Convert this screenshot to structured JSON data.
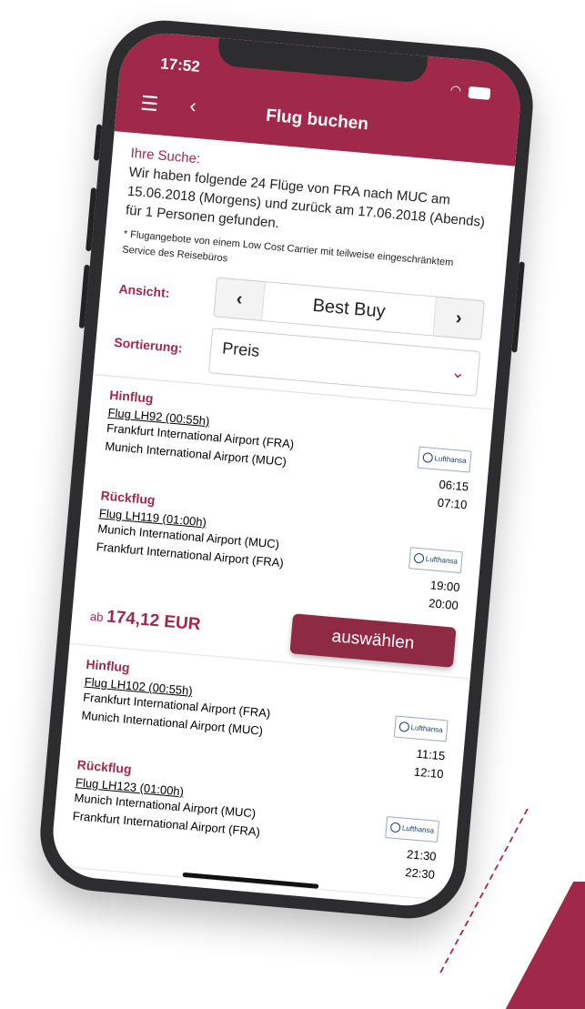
{
  "status_bar": {
    "time": "17:52"
  },
  "header": {
    "title": "Flug buchen"
  },
  "search": {
    "label": "Ihre Suche:",
    "text": "Wir haben folgende 24 Flüge von FRA nach MUC am 15.06.2018 (Morgens) und zurück am 17.06.2018 (Abends) für 1 Personen gefunden.",
    "note": "* Flugangebote von einem Low Cost Carrier mit teilweise eingeschränktem Service des Reisebüros"
  },
  "view": {
    "label": "Ansicht:",
    "value": "Best Buy"
  },
  "sort": {
    "label": "Sortierung:",
    "value": "Preis"
  },
  "airline_logo_text": "Lufthansa",
  "results": [
    {
      "outbound": {
        "title": "Hinflug",
        "flight": "Flug LH92 (00:55h)",
        "from": "Frankfurt International Airport (FRA)",
        "to": "Munich International Airport (MUC)",
        "dep": "06:15",
        "arr": "07:10"
      },
      "return": {
        "title": "Rückflug",
        "flight": "Flug LH119 (01:00h)",
        "from": "Munich International Airport (MUC)",
        "to": "Frankfurt International Airport (FRA)",
        "dep": "19:00",
        "arr": "20:00"
      },
      "price_prefix": "ab",
      "price": "174,12 EUR",
      "button": "auswählen"
    },
    {
      "outbound": {
        "title": "Hinflug",
        "flight": "Flug LH102 (00:55h)",
        "from": "Frankfurt International Airport (FRA)",
        "to": "Munich International Airport (MUC)",
        "dep": "11:15",
        "arr": "12:10"
      },
      "return": {
        "title": "Rückflug",
        "flight": "Flug LH123 (01:00h)",
        "from": "Munich International Airport (MUC)",
        "to": "Frankfurt International Airport (FRA)",
        "dep": "21:30",
        "arr": "22:30"
      }
    }
  ],
  "colors": {
    "brand": "#a0294b",
    "button": "#8f2a44"
  }
}
